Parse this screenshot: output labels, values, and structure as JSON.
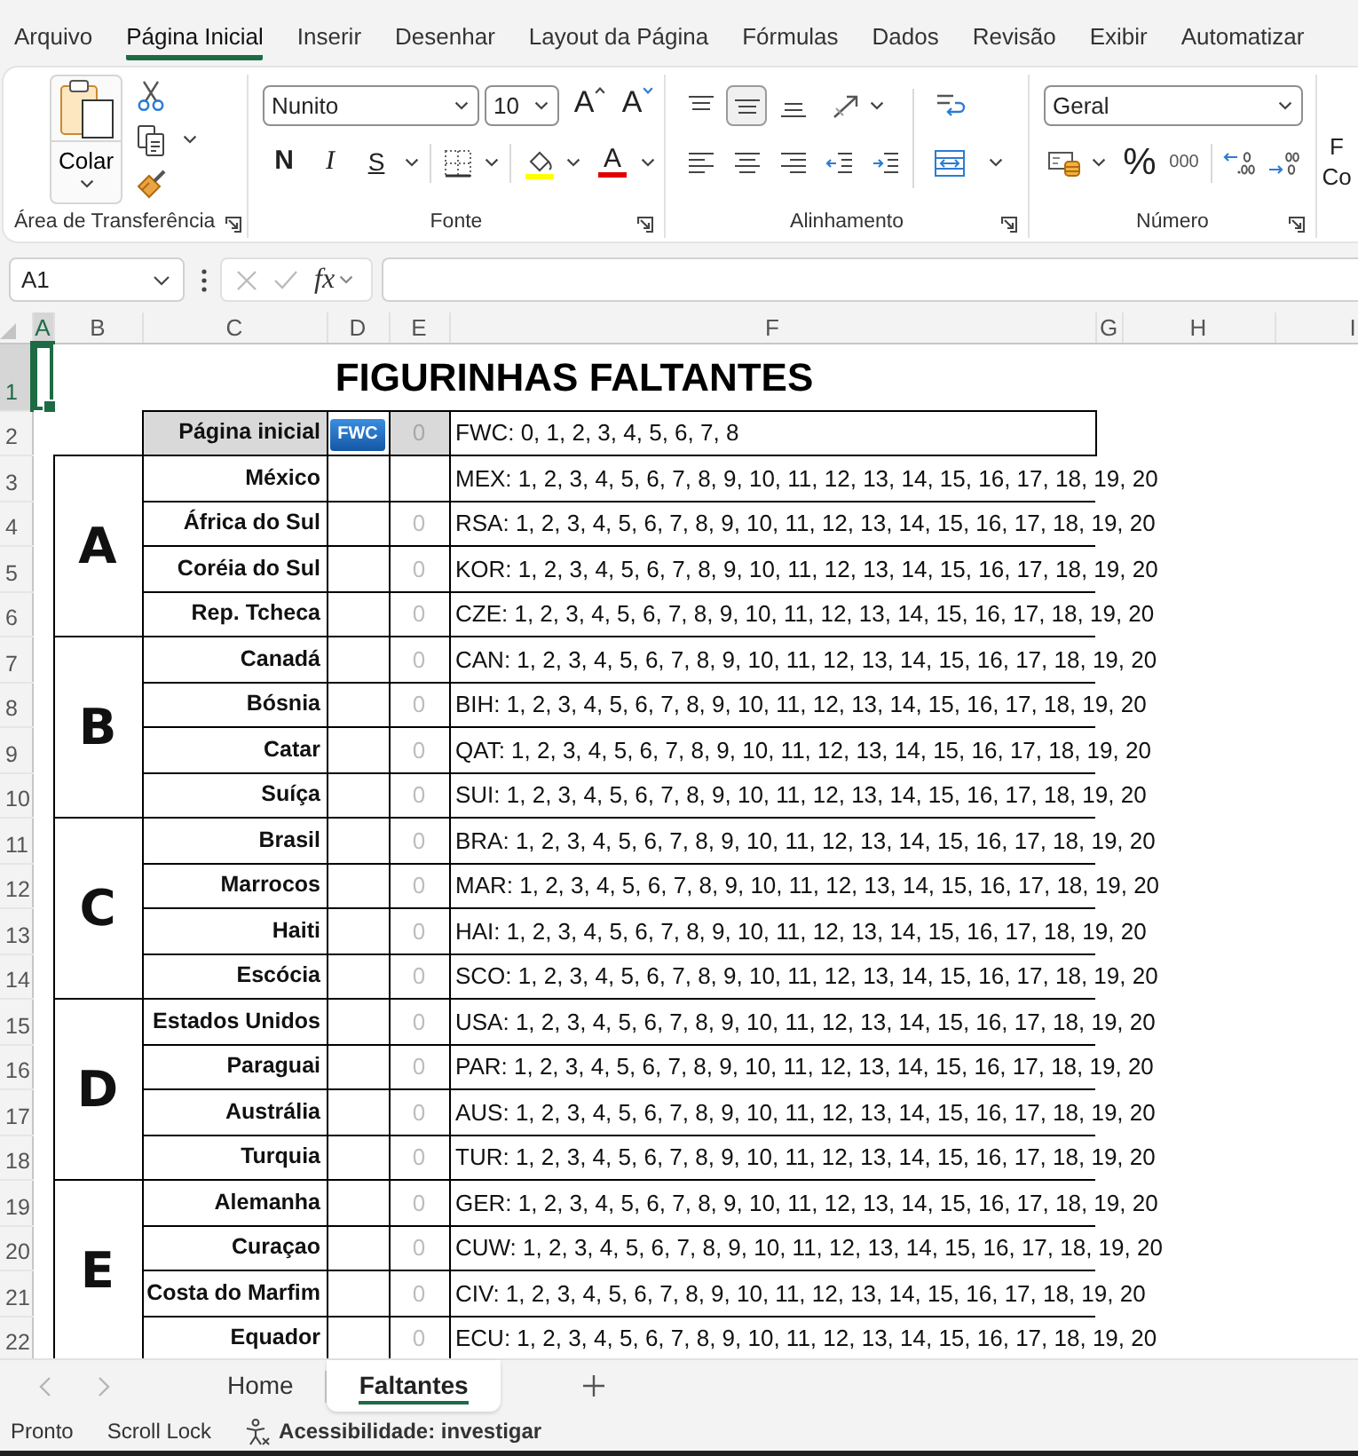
{
  "menu_tabs": [
    {
      "label": "Arquivo",
      "selected": false
    },
    {
      "label": "Página Inicial",
      "selected": true
    },
    {
      "label": "Inserir",
      "selected": false
    },
    {
      "label": "Desenhar",
      "selected": false
    },
    {
      "label": "Layout da Página",
      "selected": false
    },
    {
      "label": "Fórmulas",
      "selected": false
    },
    {
      "label": "Dados",
      "selected": false
    },
    {
      "label": "Revisão",
      "selected": false
    },
    {
      "label": "Exibir",
      "selected": false
    },
    {
      "label": "Automatizar",
      "selected": false
    }
  ],
  "ribbon": {
    "groups": [
      {
        "kind": "clipboard",
        "label": "Área de Transferência",
        "paste": "Colar"
      },
      {
        "kind": "font",
        "label": "Fonte",
        "font_name": "Nunito",
        "font_size": "10",
        "grow": "A",
        "shrink": "A",
        "bold": "N",
        "italic": "I",
        "underline": "S",
        "font_color": "A"
      },
      {
        "kind": "alignment",
        "label": "Alinhamento",
        "vertical": [
          {
            "kind": "top",
            "selected": false
          },
          {
            "kind": "middle",
            "selected": true
          },
          {
            "kind": "bottom",
            "selected": false
          }
        ],
        "horizontal": [
          {
            "kind": "left",
            "selected": false
          },
          {
            "kind": "center",
            "selected": false
          },
          {
            "kind": "right",
            "selected": false
          }
        ]
      },
      {
        "kind": "number",
        "label": "Número",
        "format": "Geral",
        "percent": "%",
        "thousands": "000"
      },
      {
        "kind": "partial",
        "lines": [
          "F",
          "Co"
        ]
      }
    ]
  },
  "formula_bar": {
    "name_box": "A1",
    "function_label": "fx"
  },
  "columns": [
    {
      "label": "A",
      "selected": true
    },
    {
      "label": "B",
      "selected": false
    },
    {
      "label": "C",
      "selected": false
    },
    {
      "label": "D",
      "selected": false
    },
    {
      "label": "E",
      "selected": false
    },
    {
      "label": "F",
      "selected": false
    },
    {
      "label": "G",
      "selected": false
    },
    {
      "label": "H",
      "selected": false
    },
    {
      "label": "I",
      "selected": false
    }
  ],
  "row_headers": [
    {
      "label": "1",
      "selected": true
    },
    {
      "label": "2",
      "selected": false
    },
    {
      "label": "3",
      "selected": false
    },
    {
      "label": "4",
      "selected": false
    },
    {
      "label": "5",
      "selected": false
    },
    {
      "label": "6",
      "selected": false
    },
    {
      "label": "7",
      "selected": false
    },
    {
      "label": "8",
      "selected": false
    },
    {
      "label": "9",
      "selected": false
    },
    {
      "label": "10",
      "selected": false
    },
    {
      "label": "11",
      "selected": false
    },
    {
      "label": "12",
      "selected": false
    },
    {
      "label": "13",
      "selected": false
    },
    {
      "label": "14",
      "selected": false
    },
    {
      "label": "15",
      "selected": false
    },
    {
      "label": "16",
      "selected": false
    },
    {
      "label": "17",
      "selected": false
    },
    {
      "label": "18",
      "selected": false
    },
    {
      "label": "19",
      "selected": false
    },
    {
      "label": "20",
      "selected": false
    },
    {
      "label": "21",
      "selected": false
    },
    {
      "label": "22",
      "selected": false
    }
  ],
  "sheet": {
    "title": "FIGURINHAS FALTANTES",
    "intro": {
      "name": "Página inicial",
      "logo": "FWC",
      "count": "0",
      "stickers": "FWC: 0, 1, 2, 3, 4, 5, 6, 7, 8"
    },
    "groups": [
      {
        "letter": "A",
        "teams": [
          {
            "name": "México",
            "stickers": "MEX: 1, 2, 3, 4, 5, 6, 7, 8, 9, 10, 11, 12, 13, 14, 15, 16, 17, 18, 19, 20"
          },
          {
            "name": "África do Sul",
            "count": "0",
            "stickers": "RSA: 1, 2, 3, 4, 5, 6, 7, 8, 9, 10, 11, 12, 13, 14, 15, 16, 17, 18, 19, 20"
          },
          {
            "name": "Coréia do Sul",
            "count": "0",
            "stickers": "KOR: 1, 2, 3, 4, 5, 6, 7, 8, 9, 10, 11, 12, 13, 14, 15, 16, 17, 18, 19, 20"
          },
          {
            "name": "Rep. Tcheca",
            "count": "0",
            "stickers": "CZE: 1, 2, 3, 4, 5, 6, 7, 8, 9, 10, 11, 12, 13, 14, 15, 16, 17, 18, 19, 20"
          }
        ]
      },
      {
        "letter": "B",
        "teams": [
          {
            "name": "Canadá",
            "count": "0",
            "stickers": "CAN: 1, 2, 3, 4, 5, 6, 7, 8, 9, 10, 11, 12, 13, 14, 15, 16, 17, 18, 19, 20"
          },
          {
            "name": "Bósnia",
            "count": "0",
            "stickers": "BIH: 1, 2, 3, 4, 5, 6, 7, 8, 9, 10, 11, 12, 13, 14, 15, 16, 17, 18, 19, 20"
          },
          {
            "name": "Catar",
            "count": "0",
            "stickers": "QAT: 1, 2, 3, 4, 5, 6, 7, 8, 9, 10, 11, 12, 13, 14, 15, 16, 17, 18, 19, 20"
          },
          {
            "name": "Suíça",
            "count": "0",
            "stickers": "SUI: 1, 2, 3, 4, 5, 6, 7, 8, 9, 10, 11, 12, 13, 14, 15, 16, 17, 18, 19, 20"
          }
        ]
      },
      {
        "letter": "C",
        "teams": [
          {
            "name": "Brasil",
            "count": "0",
            "stickers": "BRA: 1, 2, 3, 4, 5, 6, 7, 8, 9, 10, 11, 12, 13, 14, 15, 16, 17, 18, 19, 20"
          },
          {
            "name": "Marrocos",
            "count": "0",
            "stickers": "MAR: 1, 2, 3, 4, 5, 6, 7, 8, 9, 10, 11, 12, 13, 14, 15, 16, 17, 18, 19, 20"
          },
          {
            "name": "Haiti",
            "count": "0",
            "stickers": "HAI: 1, 2, 3, 4, 5, 6, 7, 8, 9, 10, 11, 12, 13, 14, 15, 16, 17, 18, 19, 20"
          },
          {
            "name": "Escócia",
            "count": "0",
            "stickers": "SCO: 1, 2, 3, 4, 5, 6, 7, 8, 9, 10, 11, 12, 13, 14, 15, 16, 17, 18, 19, 20"
          }
        ]
      },
      {
        "letter": "D",
        "teams": [
          {
            "name": "Estados Unidos",
            "count": "0",
            "stickers": "USA: 1, 2, 3, 4, 5, 6, 7, 8, 9, 10, 11, 12, 13, 14, 15, 16, 17, 18, 19, 20"
          },
          {
            "name": "Paraguai",
            "count": "0",
            "stickers": "PAR: 1, 2, 3, 4, 5, 6, 7, 8, 9, 10, 11, 12, 13, 14, 15, 16, 17, 18, 19, 20"
          },
          {
            "name": "Austrália",
            "count": "0",
            "stickers": "AUS: 1, 2, 3, 4, 5, 6, 7, 8, 9, 10, 11, 12, 13, 14, 15, 16, 17, 18, 19, 20"
          },
          {
            "name": "Turquia",
            "count": "0",
            "stickers": "TUR: 1, 2, 3, 4, 5, 6, 7, 8, 9, 10, 11, 12, 13, 14, 15, 16, 17, 18, 19, 20"
          }
        ]
      },
      {
        "letter": "E",
        "teams": [
          {
            "name": "Alemanha",
            "count": "0",
            "stickers": "GER: 1, 2, 3, 4, 5, 6, 7, 8, 9, 10, 11, 12, 13, 14, 15, 16, 17, 18, 19, 20"
          },
          {
            "name": "Curaçao",
            "count": "0",
            "stickers": "CUW: 1, 2, 3, 4, 5, 6, 7, 8, 9, 10, 11, 12, 13, 14, 15, 16, 17, 18, 19, 20"
          },
          {
            "name": "Costa do Marfim",
            "count": "0",
            "stickers": "CIV: 1, 2, 3, 4, 5, 6, 7, 8, 9, 10, 11, 12, 13, 14, 15, 16, 17, 18, 19, 20"
          },
          {
            "name": "Equador",
            "count": "0",
            "stickers": "ECU: 1, 2, 3, 4, 5, 6, 7, 8, 9, 10, 11, 12, 13, 14, 15, 16, 17, 18, 19, 20"
          }
        ]
      }
    ]
  },
  "sheet_tabs": [
    {
      "label": "Home",
      "selected": false
    },
    {
      "label": "Faltantes",
      "selected": true
    }
  ],
  "status_bar": {
    "items": [
      "Pronto",
      "Scroll Lock"
    ],
    "accessibility": "Acessibilidade: investigar"
  }
}
